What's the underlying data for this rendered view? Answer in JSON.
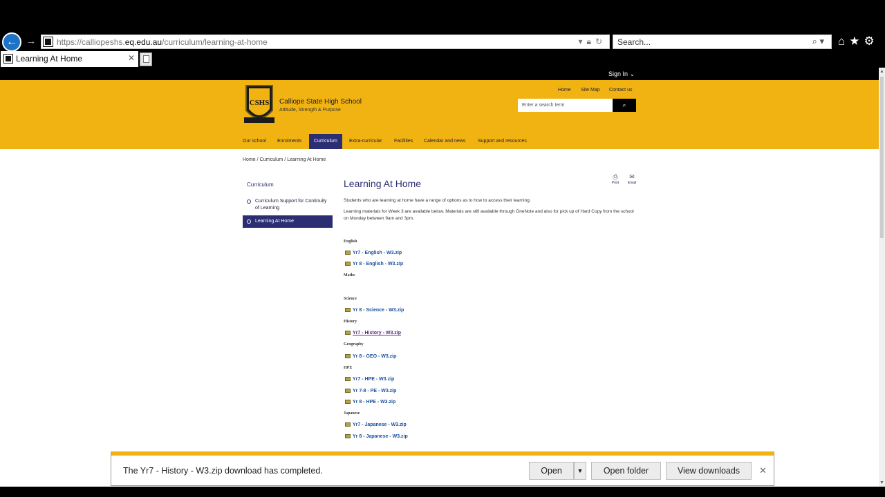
{
  "browser": {
    "url_prefix": "https://calliopeshs.",
    "url_domain": "eq.edu.au",
    "url_path": "/curriculum/learning-at-home",
    "search_placeholder": "Search...",
    "tab_title": "Learning At Home",
    "icons": [
      "back-arrow-icon",
      "forward-arrow-icon",
      "lock-icon",
      "refresh-icon",
      "search-icon",
      "home-icon",
      "star-icon",
      "gear-icon"
    ]
  },
  "site": {
    "sign_in": "Sign In",
    "school_name": "Calliope State High School",
    "tagline": "Attitude, Strength & Purpose",
    "logo_text": "CSHS",
    "utility_links": [
      "Home",
      "Site Map",
      "Contact us"
    ],
    "search_placeholder": "Enter a search term",
    "nav": [
      "Our school",
      "Enrolments",
      "Curriculum",
      "Extra-curricular",
      "Facilities",
      "Calendar and news",
      "Support and resources"
    ],
    "active_nav": "Curriculum",
    "colors": {
      "header": "#f0b312",
      "accent": "#2b2e73"
    }
  },
  "breadcrumb": [
    "Home",
    "Curriculum",
    "Learning At Home"
  ],
  "sidebar": {
    "title": "Curriculum",
    "items": [
      "Curriculum Support for Continuity of Learning",
      "Learning At Home"
    ],
    "active": "Learning At Home"
  },
  "content": {
    "title": "Learning At Home",
    "print_label": "Print",
    "email_label": "Email",
    "intro": "Students who are learning at home have a range of options as to how to access their learning.",
    "materials": "Learning materials for Week 3 are available below. Materials are still available through OneNote and also for pick up of Hard Copy from the school on Monday between 9am and 3pm.",
    "subjects": {
      "english": "English",
      "maths": "Maths",
      "science": "Science",
      "history": "History",
      "geography": "Geography",
      "hpe": "HPE",
      "japanese": "Japanese"
    },
    "files": {
      "yr7_english": "Yr7 - English - W3.zip",
      "yr8_english": "Yr 8 - English - W3.zip",
      "yr8_science": "Yr 8 - Science - W3.zip",
      "yr7_history": "Yr7 - History - W3.zip",
      "yr8_geo": "Yr 8 - GEO - W3.zip",
      "yr7_hpe": "Yr7 - HPE - W3.zip",
      "yr78_pe": "Yr 7-8 - PE - W3.zip",
      "yr8_hpe": "Yr 8 - HPE - W3.zip",
      "yr7_japanese": "Yr7 - Japanese - W3.zip",
      "yr8_japanese": "Yr 8 - Japanese - W3.zip"
    }
  },
  "download": {
    "message": "The Yr7 - History - W3.zip download has completed.",
    "open": "Open",
    "open_folder": "Open folder",
    "view_downloads": "View downloads"
  }
}
